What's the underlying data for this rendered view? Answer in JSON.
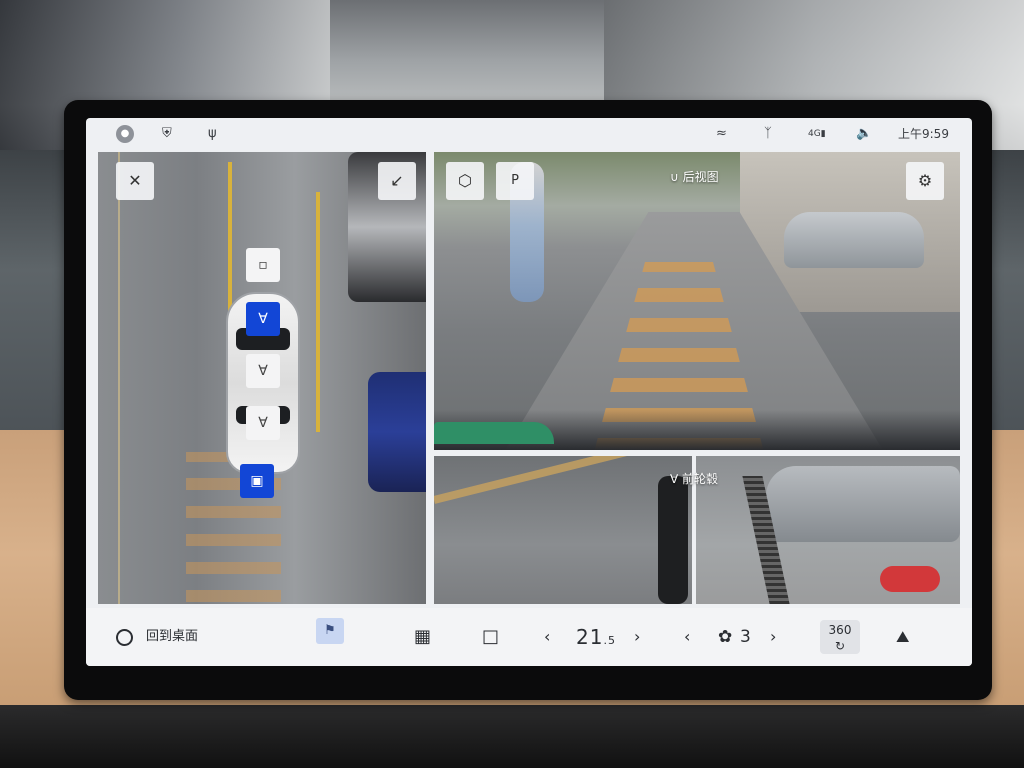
{
  "status_bar": {
    "time": "上午9:59",
    "network": "4G",
    "icons": [
      "avatar-icon",
      "shield-icon",
      "usb-icon",
      "wifi-icon",
      "bluetooth-icon",
      "signal-icon",
      "volume-icon"
    ]
  },
  "camera": {
    "rear_view_label": "后视图",
    "front_wheel_label": "前轮毂",
    "parking_assist_label": "P"
  },
  "dock": {
    "home_label": "回到桌面",
    "temperature_main": "21",
    "temperature_decimal": ".5",
    "fan_level": "3",
    "view_360_label": "360"
  }
}
